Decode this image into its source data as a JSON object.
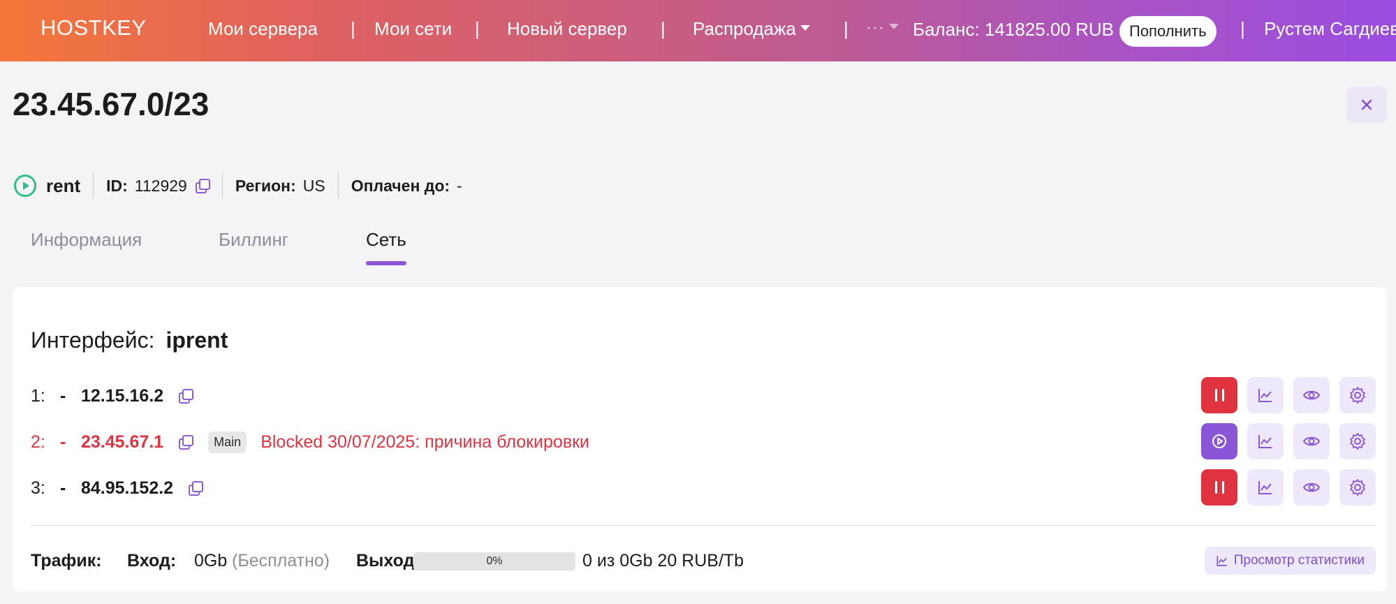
{
  "navbar": {
    "logo": "HOSTKEY",
    "items": [
      {
        "label": "Мои сервера"
      },
      {
        "label": "Мои сети"
      },
      {
        "label": "Новый сервер"
      },
      {
        "label": "Распродажа"
      }
    ],
    "separator": "|",
    "more": "···",
    "balance": "Баланс: 141825.00 RUB",
    "topup_label": "Пополнить",
    "user": "Рустем Сагдиев"
  },
  "header": {
    "title": "23.45.67.0/23",
    "close_icon": "close-icon",
    "status": "rent",
    "id_label": "ID:",
    "id_value": "112929",
    "region_label": "Регион:",
    "region_value": "US",
    "paid_label": "Оплачен до:",
    "paid_value": "-"
  },
  "tabs": [
    {
      "label": "Информация",
      "active": false
    },
    {
      "label": "Биллинг",
      "active": false
    },
    {
      "label": "Сеть",
      "active": true
    }
  ],
  "interface": {
    "label": "Интерфейс:",
    "name": "iprent",
    "ips": [
      {
        "num": "1:",
        "dash": "-",
        "ip": "12.15.16.2",
        "badge": "",
        "blocked_text": "",
        "state": "active"
      },
      {
        "num": "2:",
        "dash": "-",
        "ip": "23.45.67.1",
        "badge": "Main",
        "blocked_text": "Blocked 30/07/2025: причина блокировки",
        "state": "blocked"
      },
      {
        "num": "3:",
        "dash": "-",
        "ip": "84.95.152.2",
        "badge": "",
        "blocked_text": "",
        "state": "active"
      }
    ]
  },
  "traffic": {
    "label": "Трафик:",
    "in_label": "Вход:",
    "in_value": "0Gb",
    "in_note": "(Бесплатно)",
    "out_label": "Выход:",
    "progress_text": "0%",
    "progress_fraction": 0,
    "out_value": "0 из 0Gb 20 RUB/Tb",
    "stats_label": "Просмотр статистики"
  },
  "colors": {
    "accent": "#8a55d6",
    "danger": "#e0323f",
    "success": "#2fbf85"
  }
}
